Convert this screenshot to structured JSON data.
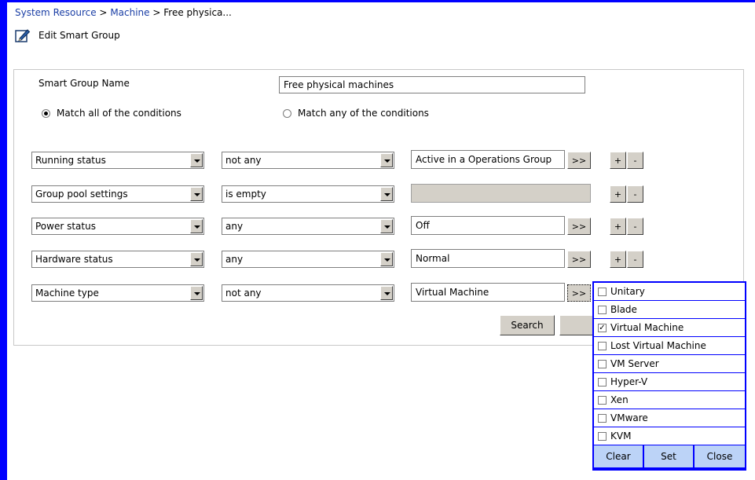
{
  "breadcrumb": {
    "item1": "System Resource",
    "sep1": ">",
    "item2": "Machine",
    "sep2": ">",
    "item3": "Free physica..."
  },
  "page": {
    "title": "Edit Smart Group",
    "title_icon": "edit-pencil-icon"
  },
  "form": {
    "name_label": "Smart Group Name",
    "name_value": "Free physical machines",
    "match_all_label": "Match all of the conditions",
    "match_any_label": "Match any of the conditions",
    "match_mode": "all"
  },
  "conditions": [
    {
      "field": "Running status",
      "operator": "not any",
      "value": "Active in a Operations Group",
      "more_label": ">>",
      "add_label": "+",
      "remove_label": "-"
    },
    {
      "field": "Group pool settings",
      "operator": "is empty",
      "value": "",
      "add_label": "+",
      "remove_label": "-"
    },
    {
      "field": "Power status",
      "operator": "any",
      "value": "Off",
      "more_label": ">>",
      "add_label": "+",
      "remove_label": "-"
    },
    {
      "field": "Hardware status",
      "operator": "any",
      "value": "Normal",
      "more_label": ">>",
      "add_label": "+",
      "remove_label": "-"
    },
    {
      "field": "Machine type",
      "operator": "not any",
      "value": "Virtual Machine",
      "more_label": ">>"
    }
  ],
  "search_label": "Search",
  "popup": {
    "options": [
      {
        "label": "Unitary",
        "checked": false
      },
      {
        "label": "Blade",
        "checked": false
      },
      {
        "label": "Virtual Machine",
        "checked": true
      },
      {
        "label": "Lost Virtual Machine",
        "checked": false
      },
      {
        "label": "VM Server",
        "checked": false
      },
      {
        "label": "Hyper-V",
        "checked": false
      },
      {
        "label": "Xen",
        "checked": false
      },
      {
        "label": "VMware",
        "checked": false
      },
      {
        "label": "KVM",
        "checked": false
      }
    ],
    "clear_label": "Clear",
    "set_label": "Set",
    "close_label": "Close",
    "check_mark": "✓"
  },
  "colors": {
    "frame": "#0000ff",
    "link": "#1a3ea5",
    "popup_button": "#bcd3f7"
  }
}
